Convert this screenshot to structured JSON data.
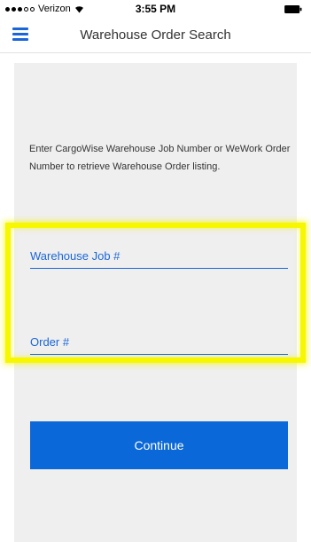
{
  "status_bar": {
    "carrier": "Verizon",
    "time": "3:55 PM",
    "signal_icon": "signal-dots-icon",
    "wifi_icon": "wifi-icon",
    "battery_icon": "battery-icon"
  },
  "nav": {
    "menu_icon": "hamburger-menu-icon",
    "title": "Warehouse Order Search",
    "accent_color": "#1a66d9"
  },
  "main": {
    "instructions": "Enter CargoWise Warehouse Job Number or WeWork Order Number to retrieve Warehouse Order listing.",
    "fields": [
      {
        "label": "Warehouse Job #",
        "value": ""
      },
      {
        "label": "Order #",
        "value": ""
      }
    ],
    "highlight_color": "#f6f700",
    "continue_label": "Continue",
    "button_color": "#0a68d8"
  }
}
